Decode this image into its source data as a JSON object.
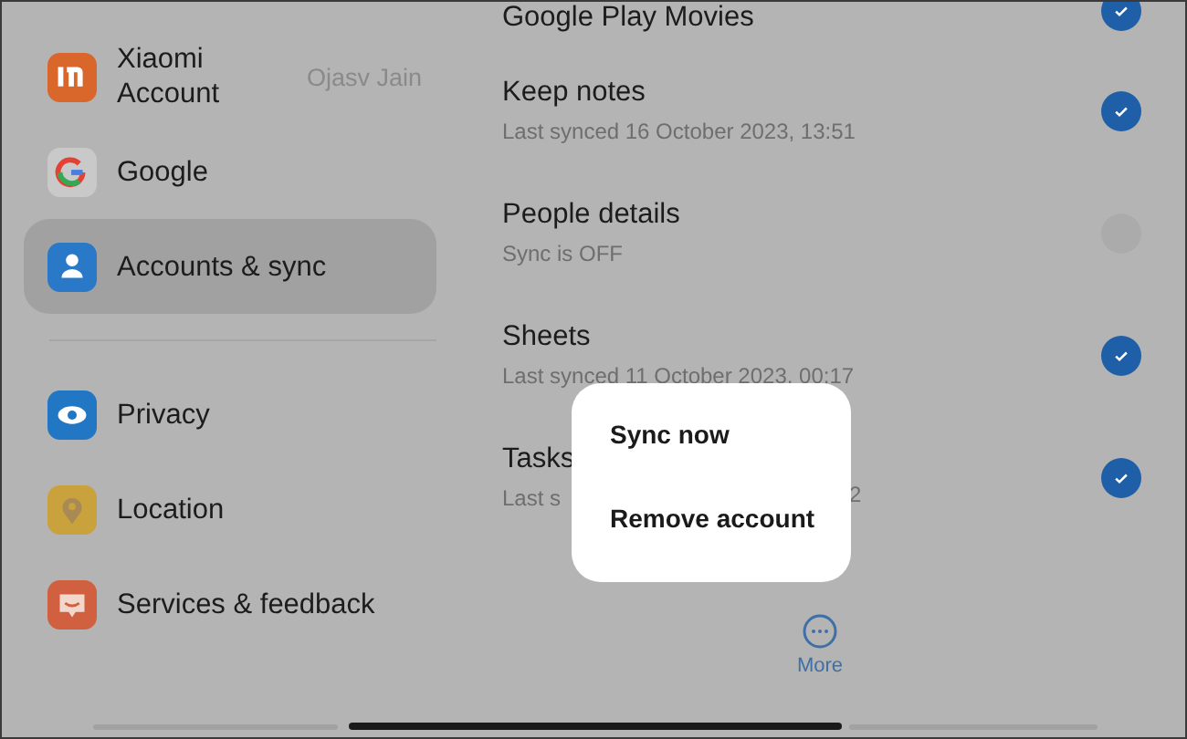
{
  "sidebar": {
    "items": [
      {
        "kind": "xiaomi",
        "label": "Xiaomi Account",
        "value": "Ojasv Jain",
        "selected": false
      },
      {
        "kind": "google",
        "label": "Google",
        "selected": false
      },
      {
        "kind": "accounts",
        "label": "Accounts & sync",
        "selected": true
      },
      {
        "kind": "divider"
      },
      {
        "kind": "privacy",
        "label": "Privacy",
        "selected": false
      },
      {
        "kind": "location",
        "label": "Location",
        "selected": false
      },
      {
        "kind": "services",
        "label": "Services & feedback",
        "selected": false
      }
    ]
  },
  "sync_items": [
    {
      "title": "Google Play Movies",
      "checked": true
    },
    {
      "title": "Keep notes",
      "subtitle": "Last synced 16 October 2023, 13:51",
      "checked": true
    },
    {
      "title": "People details",
      "subtitle": "Sync is OFF",
      "checked": false
    },
    {
      "title": "Sheets",
      "subtitle": "Last synced 11 October 2023, 00:17",
      "checked": true
    },
    {
      "title": "Tasks",
      "subtitle": "Last s",
      "subtitle_tail": "2",
      "checked": true
    }
  ],
  "menu": {
    "items": [
      "Sync now",
      "Remove account"
    ]
  },
  "bottom_action": {
    "label": "More"
  }
}
